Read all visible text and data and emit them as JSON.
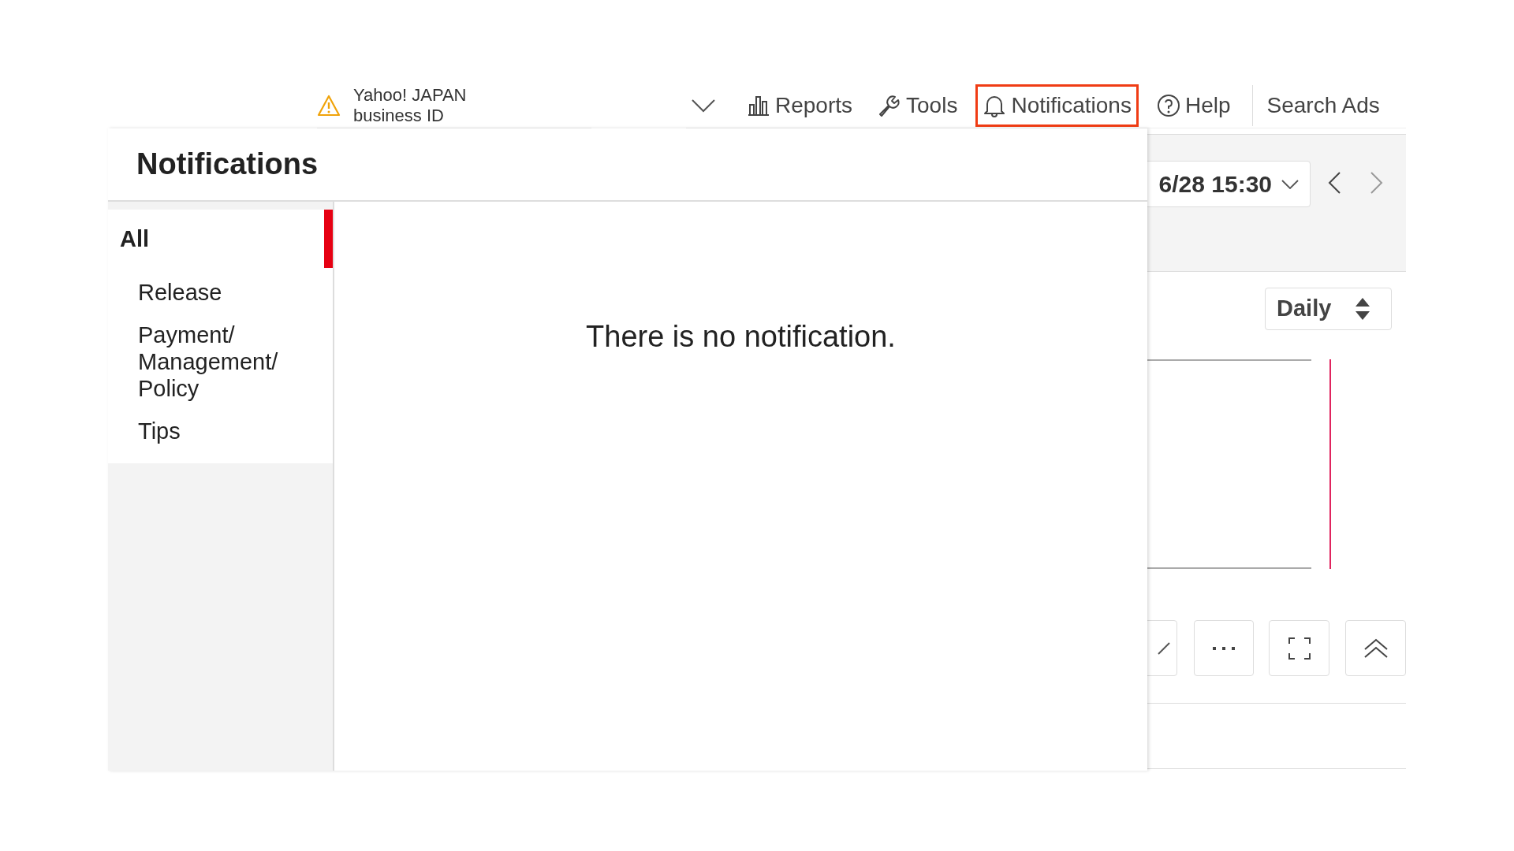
{
  "account_notice": {
    "lines": [
      "Yahoo! JAPAN",
      "business ID"
    ]
  },
  "nav": [
    {
      "label": "Reports",
      "selected": false
    },
    {
      "label": "Tools",
      "selected": false
    },
    {
      "label": "Notifications",
      "selected": true
    },
    {
      "label": "Help",
      "selected": false
    }
  ],
  "search_ads": "Search Ads",
  "panel": {
    "title": "Notifications",
    "categories": [
      {
        "label": "All",
        "selected": true
      },
      {
        "label": "Release",
        "selected": false
      },
      {
        "label": "Payment/ Management/ Policy",
        "selected": false
      },
      {
        "label": "Tips",
        "selected": false
      }
    ],
    "empty_message": "There is no notification."
  },
  "background": {
    "date_range": "6/28 15:30",
    "granularity": "Daily"
  }
}
